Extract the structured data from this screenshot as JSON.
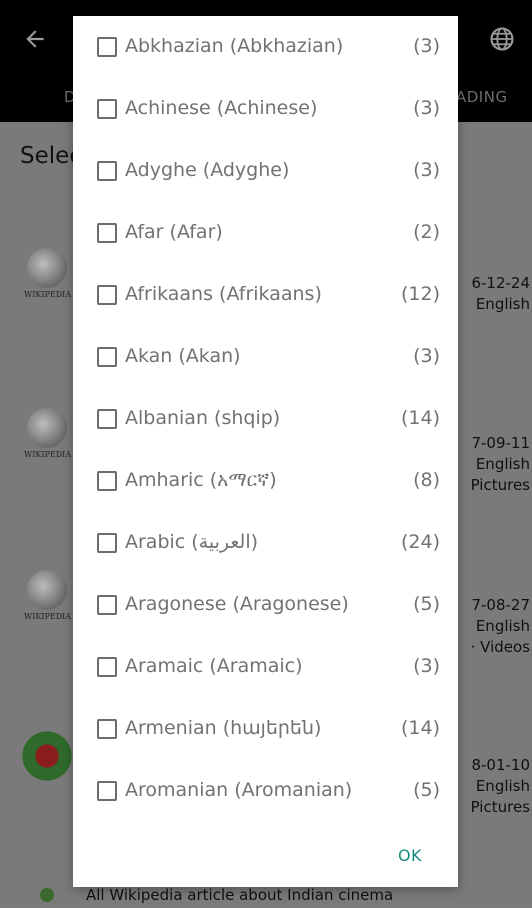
{
  "background": {
    "tab_left_fragment": "D",
    "tab_right_fragment": "ADING",
    "page_title_fragment": "Selec",
    "entries": [
      {
        "meta": [
          "6-12-24",
          "English"
        ]
      },
      {
        "meta": [
          "7-09-11",
          "English",
          "Pictures"
        ]
      },
      {
        "meta": [
          "7-08-27",
          "English",
          "· Videos"
        ]
      },
      {
        "meta": [
          "8-01-10",
          "English",
          "Pictures"
        ]
      }
    ],
    "footer_title": "All Wikipedia article about Indian cinema",
    "logo_text": "WIKIPEDIA"
  },
  "dialog": {
    "languages": [
      {
        "label": "Abkhazian (Abkhazian)",
        "count": "(3)"
      },
      {
        "label": "Achinese (Achinese)",
        "count": "(3)"
      },
      {
        "label": "Adyghe (Adyghe)",
        "count": "(3)"
      },
      {
        "label": "Afar (Afar)",
        "count": "(2)"
      },
      {
        "label": "Afrikaans (Afrikaans)",
        "count": "(12)"
      },
      {
        "label": "Akan (Akan)",
        "count": "(3)"
      },
      {
        "label": "Albanian (shqip)",
        "count": "(14)"
      },
      {
        "label": "Amharic (አማርኛ)",
        "count": "(8)"
      },
      {
        "label": "Arabic (العربية)",
        "count": "(24)"
      },
      {
        "label": "Aragonese (Aragonese)",
        "count": "(5)"
      },
      {
        "label": "Aramaic (Aramaic)",
        "count": "(3)"
      },
      {
        "label": "Armenian (հայերեն)",
        "count": "(14)"
      },
      {
        "label": "Aromanian (Aromanian)",
        "count": "(5)"
      }
    ],
    "ok_label": "OK"
  }
}
